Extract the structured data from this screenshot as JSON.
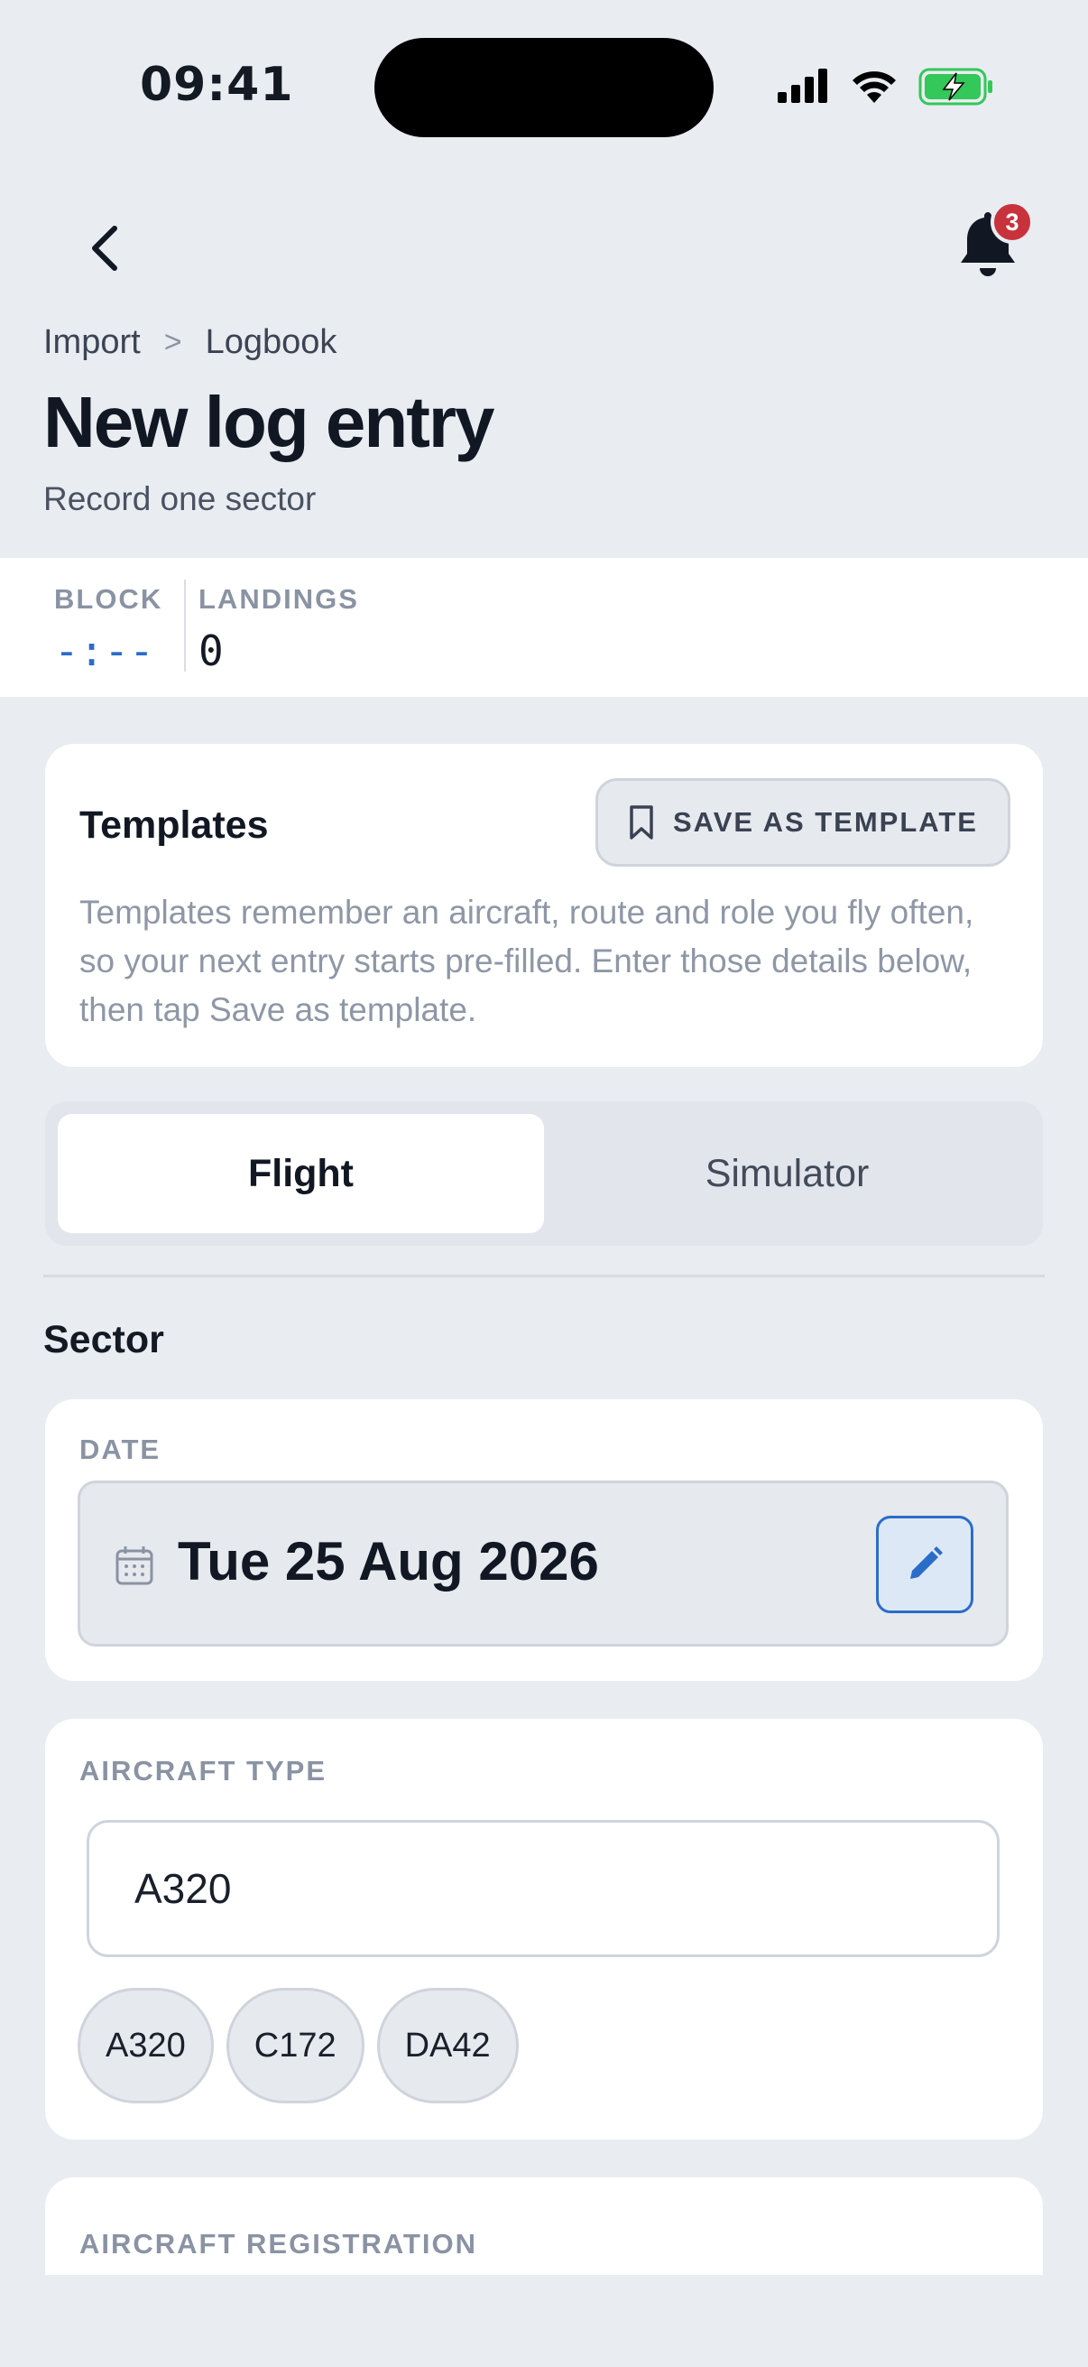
{
  "status_bar": {
    "time": "09:41"
  },
  "header": {
    "notification_count": "3"
  },
  "breadcrumb": {
    "parent": "Import",
    "separator": ">",
    "current": "Logbook"
  },
  "page": {
    "title": "New log entry",
    "subtitle": "Record one sector"
  },
  "stats": {
    "block_label": "BLOCK",
    "block_value": "-:--",
    "landings_label": "LANDINGS",
    "landings_value": "0"
  },
  "templates": {
    "heading": "Templates",
    "save_label": "SAVE AS TEMPLATE",
    "description": "Templates remember an aircraft, route and role you fly often, so your next entry starts pre-filled. Enter those details below, then tap Save as template."
  },
  "mode_tabs": {
    "flight": "Flight",
    "simulator": "Simulator",
    "selected": "Flight"
  },
  "sector": {
    "title": "Sector",
    "date_label": "DATE",
    "date_value": "Tue 25 Aug 2026",
    "aircraft_type_label": "AIRCRAFT TYPE",
    "aircraft_type_value": "A320",
    "aircraft_suggestions": [
      "A320",
      "C172",
      "DA42"
    ],
    "aircraft_registration_label": "AIRCRAFT REGISTRATION"
  },
  "colors": {
    "accent": "#2a6dc9",
    "badge": "#c8323c",
    "battery": "#34c759"
  },
  "icons": [
    "back-arrow-icon",
    "bell-icon",
    "bookmark-icon",
    "calendar-icon",
    "pencil-icon"
  ]
}
